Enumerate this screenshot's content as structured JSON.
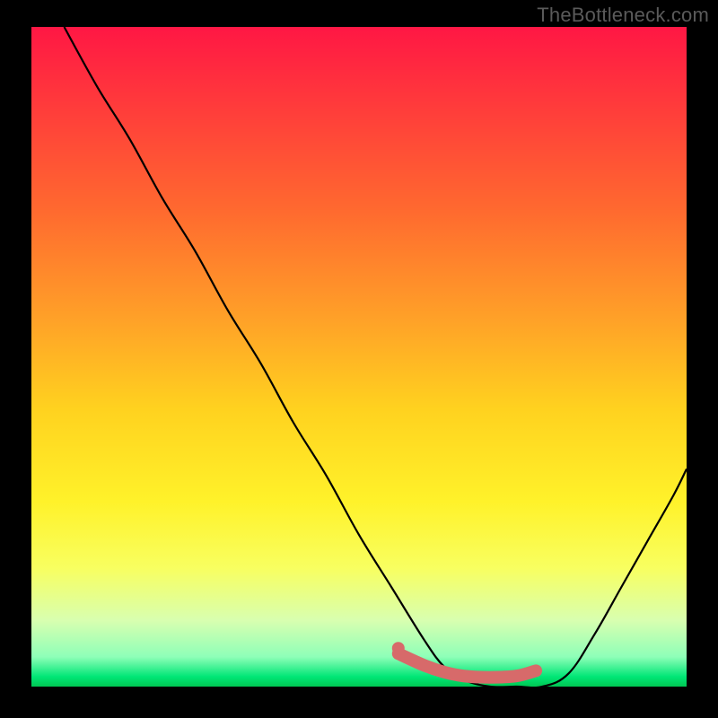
{
  "watermark": "TheBottleneck.com",
  "colors": {
    "frame_bg": "#000000",
    "watermark_text": "#5a5a5a",
    "curve_stroke": "#000000",
    "marker_fill": "#d76a6a",
    "gradient_stops": [
      {
        "offset": 0.0,
        "color": "#ff1744"
      },
      {
        "offset": 0.12,
        "color": "#ff3b3b"
      },
      {
        "offset": 0.28,
        "color": "#ff6a2f"
      },
      {
        "offset": 0.44,
        "color": "#ffa028"
      },
      {
        "offset": 0.58,
        "color": "#ffd21f"
      },
      {
        "offset": 0.72,
        "color": "#fff22a"
      },
      {
        "offset": 0.82,
        "color": "#f8ff60"
      },
      {
        "offset": 0.9,
        "color": "#d8ffb0"
      },
      {
        "offset": 0.955,
        "color": "#8effb8"
      },
      {
        "offset": 0.985,
        "color": "#00e676"
      },
      {
        "offset": 1.0,
        "color": "#00c853"
      }
    ]
  },
  "chart_data": {
    "type": "line",
    "title": "",
    "xlabel": "",
    "ylabel": "",
    "xlim": [
      0,
      100
    ],
    "ylim": [
      0,
      100
    ],
    "series": [
      {
        "name": "bottleneck-curve",
        "x": [
          5,
          10,
          15,
          20,
          25,
          30,
          35,
          40,
          45,
          50,
          55,
          60,
          63,
          66,
          70,
          74,
          78,
          82,
          86,
          90,
          94,
          98,
          100
        ],
        "values": [
          100,
          91,
          83,
          74,
          66,
          57,
          49,
          40,
          32,
          23,
          15,
          7,
          3,
          1,
          0,
          0,
          0,
          2,
          8,
          15,
          22,
          29,
          33
        ]
      }
    ],
    "markers": {
      "name": "optimal-range",
      "x": [
        56,
        60,
        63,
        66,
        70,
        74,
        77
      ],
      "values": [
        5.0,
        3.2,
        2.2,
        1.6,
        1.4,
        1.6,
        2.4
      ]
    }
  }
}
